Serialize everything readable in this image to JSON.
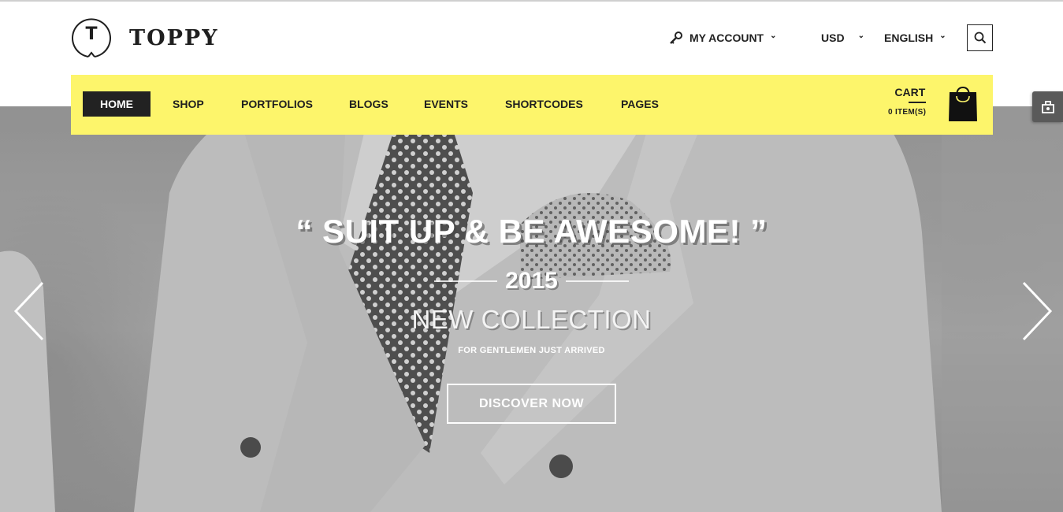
{
  "brand": {
    "name": "TOPPY",
    "logo_letter": "T"
  },
  "header": {
    "account_label": "MY ACCOUNT",
    "currency": "USD",
    "language": "ENGLISH"
  },
  "nav": {
    "items": [
      {
        "label": "HOME",
        "active": true
      },
      {
        "label": "SHOP"
      },
      {
        "label": "PORTFOLIOS"
      },
      {
        "label": "BLOGS"
      },
      {
        "label": "EVENTS"
      },
      {
        "label": "SHORTCODES"
      },
      {
        "label": "PAGES"
      }
    ],
    "cart_label": "CART",
    "cart_count": "0  ITEM(S)"
  },
  "hero": {
    "headline": "“ SUIT UP & BE AWESOME! ”",
    "year": "2015",
    "collection": "NEW COLLECTION",
    "subtitle": "FOR GENTLEMEN JUST ARRIVED",
    "cta": "DISCOVER NOW"
  },
  "colors": {
    "accent": "#fdf56b",
    "dark": "#222222",
    "hero_overlay": "#9a9a9a"
  },
  "icons": [
    "key-icon",
    "chevron-down-icon",
    "search-icon",
    "shopping-bag-icon",
    "arrow-left-icon",
    "arrow-right-icon",
    "settings-toggle-icon"
  ]
}
